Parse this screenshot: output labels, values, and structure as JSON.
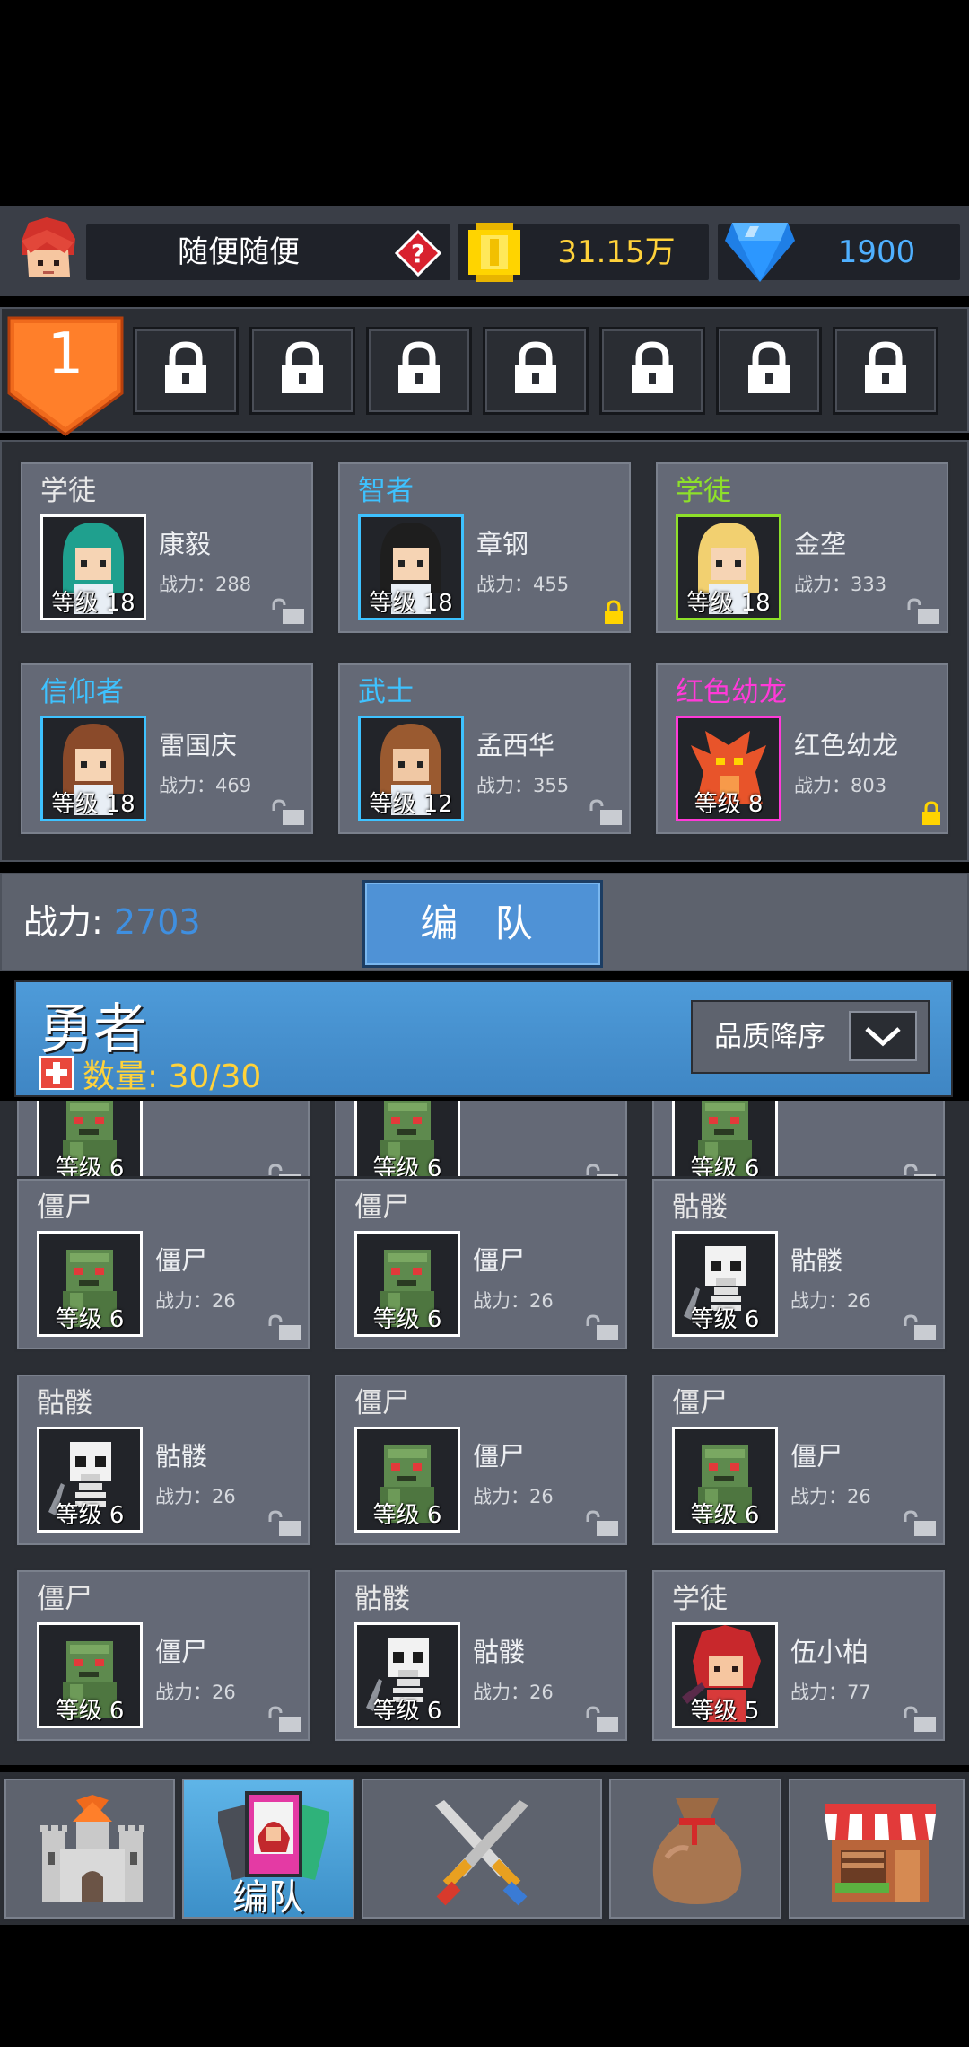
{
  "player": {
    "name": "随便随便",
    "gold": "31.15万",
    "gems": "1900"
  },
  "team_slots": {
    "active_number": "1",
    "locked_count": 7
  },
  "team": [
    {
      "role": "学徒",
      "role_color": "#e8e8e8",
      "name": "康毅",
      "power": "战力：288",
      "level": "等级 18",
      "border": "#ffffff",
      "locked": false
    },
    {
      "role": "智者",
      "role_color": "#3ec2ff",
      "name": "章钢",
      "power": "战力：455",
      "level": "等级 18",
      "border": "#3ec2ff",
      "locked": true
    },
    {
      "role": "学徒",
      "role_color": "#8ee02a",
      "name": "金垄",
      "power": "战力：333",
      "level": "等级 18",
      "border": "#8ee02a",
      "locked": false
    },
    {
      "role": "信仰者",
      "role_color": "#3ec2ff",
      "name": "雷国庆",
      "power": "战力：469",
      "level": "等级 18",
      "border": "#3ec2ff",
      "locked": false
    },
    {
      "role": "武士",
      "role_color": "#3ec2ff",
      "name": "孟西华",
      "power": "战力：355",
      "level": "等级 12",
      "border": "#3ec2ff",
      "locked": false
    },
    {
      "role": "红色幼龙",
      "role_color": "#ff3ad8",
      "name": "红色幼龙",
      "power": "战力：803",
      "level": "等级 8",
      "border": "#ff3ad8",
      "locked": true
    }
  ],
  "summary": {
    "power_label": "战力:",
    "power_value": "2703",
    "formation_button": "编 队"
  },
  "hero_section": {
    "title": "勇者",
    "count_label": "数量: 30/30",
    "sort_label": "品质降序"
  },
  "partial_row_levels": [
    "等级 6",
    "等级 6",
    "等级 6"
  ],
  "heroes": [
    {
      "role": "僵尸",
      "name": "僵尸",
      "power": "战力：26",
      "level": "等级 6",
      "kind": "zombie"
    },
    {
      "role": "僵尸",
      "name": "僵尸",
      "power": "战力：26",
      "level": "等级 6",
      "kind": "zombie"
    },
    {
      "role": "骷髅",
      "name": "骷髅",
      "power": "战力：26",
      "level": "等级 6",
      "kind": "skeleton"
    },
    {
      "role": "骷髅",
      "name": "骷髅",
      "power": "战力：26",
      "level": "等级 6",
      "kind": "skeleton"
    },
    {
      "role": "僵尸",
      "name": "僵尸",
      "power": "战力：26",
      "level": "等级 6",
      "kind": "zombie"
    },
    {
      "role": "僵尸",
      "name": "僵尸",
      "power": "战力：26",
      "level": "等级 6",
      "kind": "zombie"
    },
    {
      "role": "僵尸",
      "name": "僵尸",
      "power": "战力：26",
      "level": "等级 6",
      "kind": "zombie"
    },
    {
      "role": "骷髅",
      "name": "骷髅",
      "power": "战力：26",
      "level": "等级 6",
      "kind": "skeleton"
    },
    {
      "role": "学徒",
      "name": "伍小柏",
      "power": "战力：77",
      "level": "等级 5",
      "kind": "redhair"
    }
  ],
  "bottom_nav": [
    {
      "icon": "castle-icon",
      "label": ""
    },
    {
      "icon": "formation-card-icon",
      "label": "编队",
      "active": true
    },
    {
      "icon": "crossed-swords-icon",
      "label": ""
    },
    {
      "icon": "bag-icon",
      "label": ""
    },
    {
      "icon": "shop-icon",
      "label": ""
    }
  ],
  "colors": {
    "accent_blue": "#4f92d6",
    "gold_text": "#ffd23a",
    "gem_text": "#4fb0ff",
    "power_value": "#3f8fe0",
    "slot_orange": "#f06a1c"
  }
}
